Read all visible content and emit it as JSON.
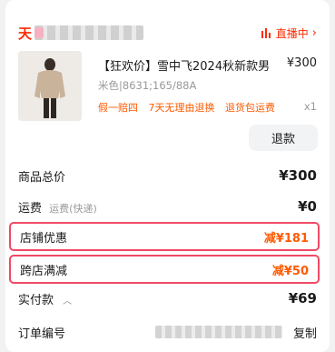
{
  "header": {
    "shop_prefix": "天",
    "live_label": "直播中",
    "live_chevron": "›"
  },
  "product": {
    "title": "【狂欢价】雪中飞2024秋新款男",
    "price": "¥300",
    "sku": "米色|8631;165/88A",
    "tags": [
      "假一赔四",
      "7天无理由退换",
      "退货包运费"
    ],
    "quantity": "x1",
    "refund_label": "退款"
  },
  "summary": {
    "subtotal_label": "商品总价",
    "subtotal_value": "¥300",
    "shipping_label": "运费",
    "shipping_sub": "运费(快递)",
    "shipping_value": "¥0",
    "store_discount_label": "店铺优惠",
    "store_discount_value": "减¥181",
    "cross_store_label": "跨店满减",
    "cross_store_value": "减¥50",
    "paid_label": "实付款",
    "paid_caret": "︿",
    "paid_value": "¥69",
    "order_no_label": "订单编号",
    "copy_label": "复制"
  },
  "colors": {
    "accent": "#ff2a00",
    "discount": "#ff5a00",
    "highlight_border": "#f04a65"
  },
  "icons": [
    "live-bars-icon",
    "chevron-right-icon",
    "chevron-up-icon"
  ]
}
